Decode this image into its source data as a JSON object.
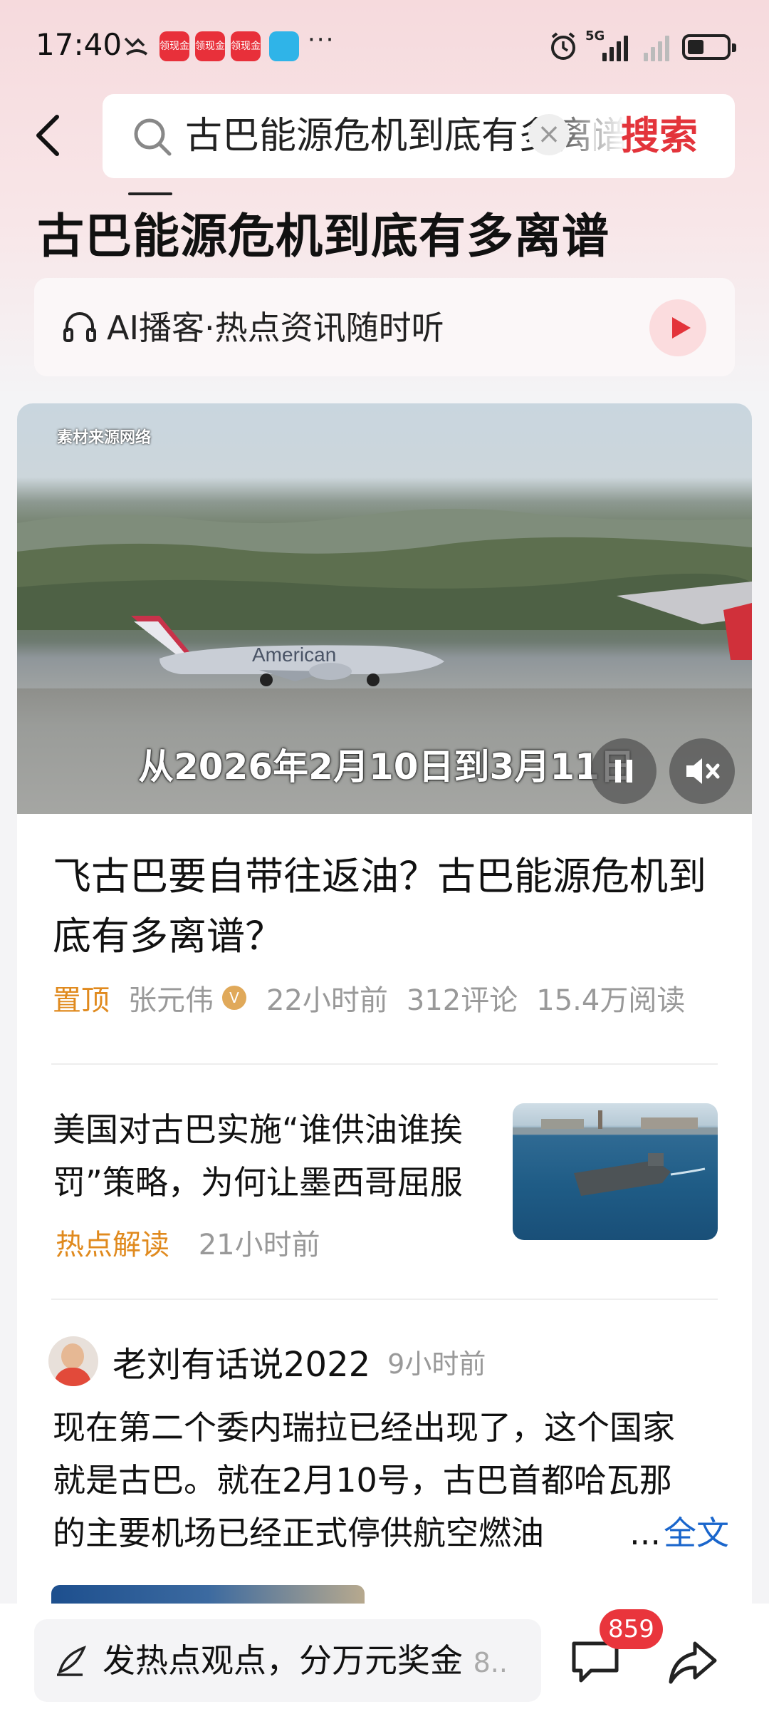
{
  "status_bar": {
    "time": "17:40",
    "app_badges": [
      "领现金",
      "领现金",
      "领现金"
    ],
    "more": "···",
    "network": "5G"
  },
  "search": {
    "query": "古巴能源危机到底有多离谱",
    "submit_label": "搜索"
  },
  "page_title": "古巴能源危机到底有多离谱",
  "ai_podcast": {
    "label": "AI播客·热点资讯随时听"
  },
  "video": {
    "watermark": "素材来源网络",
    "subtitle": "从2026年2月10日到3月11日"
  },
  "article": {
    "title": "飞古巴要自带往返油？古巴能源危机到底有多离谱？",
    "pinned": "置顶",
    "author": "张元伟",
    "verified_badge": "V",
    "time": "22小时前",
    "comments": "312评论",
    "reads": "15.4万阅读"
  },
  "news2": {
    "title": "美国对古巴实施“谁供油谁挨罚”策略，为何让墨西哥屈服",
    "tag": "热点解读",
    "time": "21小时前"
  },
  "post": {
    "username": "老刘有话说2022",
    "time": "9小时前",
    "line1": "现在第二个委内瑞拉已经出现了，这个国家",
    "line2": "就是古巴。就在2月10号，古巴首都哈瓦那",
    "line3": "的主要机场已经正式停供航空燃油",
    "ellipsis": "...",
    "more_label": "全文"
  },
  "bottom_bar": {
    "comment_placeholder": "发热点观点，分万元奖金",
    "placeholder_suffix": "8..",
    "comment_count": "859"
  },
  "colors": {
    "accent": "#e3343b",
    "tag": "#e08a1e",
    "link": "#1a66cc"
  }
}
